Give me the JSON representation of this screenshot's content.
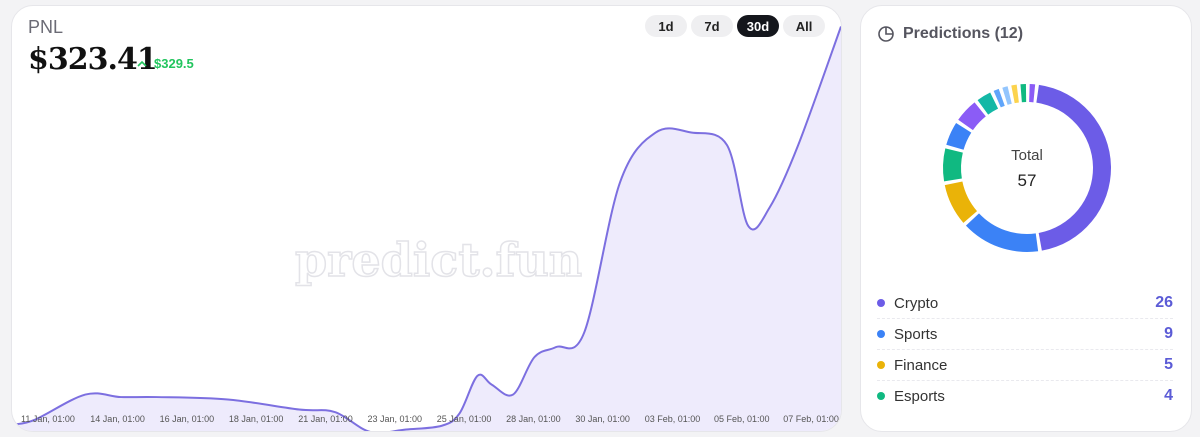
{
  "pnl": {
    "label": "PNL",
    "value": "$323.41",
    "change": "$329.5",
    "ranges": [
      {
        "label": "1d",
        "active": false
      },
      {
        "label": "7d",
        "active": false
      },
      {
        "label": "30d",
        "active": true
      },
      {
        "label": "All",
        "active": false
      }
    ],
    "watermark": "predict.fun"
  },
  "chart_data": {
    "type": "area",
    "x_labels": [
      "11 Jan, 01:00",
      "14 Jan, 01:00",
      "16 Jan, 01:00",
      "18 Jan, 01:00",
      "21 Jan, 01:00",
      "23 Jan, 01:00",
      "25 Jan, 01:00",
      "28 Jan, 01:00",
      "30 Jan, 01:00",
      "03 Feb, 01:00",
      "05 Feb, 01:00",
      "07 Feb, 01:00"
    ],
    "series": [
      {
        "color": "#7c6fe0",
        "fill": "#ebe7fb",
        "x": [
          0,
          0.3,
          1,
          1.5,
          2,
          3,
          4,
          4.5,
          5,
          5.5,
          6,
          6.25,
          6.5,
          6.7,
          7,
          7.3,
          7.6,
          8,
          8.5,
          9,
          9.5,
          10,
          10.3,
          10.6,
          11,
          11.6
        ],
        "y": [
          6,
          10,
          30,
          28,
          28,
          26,
          18,
          16,
          0,
          2,
          5,
          15,
          45,
          38,
          30,
          60,
          68,
          80,
          200,
          240,
          240,
          230,
          165,
          180,
          230,
          325
        ]
      }
    ],
    "ylim": [
      0,
      335
    ],
    "xlim": [
      0,
      11.6
    ]
  },
  "predictions": {
    "title": "Predictions (12)",
    "total_label": "Total",
    "total_value": "57",
    "segments": [
      {
        "value": 26,
        "color": "#6c5ce7"
      },
      {
        "value": 9,
        "color": "#3b82f6"
      },
      {
        "value": 5,
        "color": "#eab308"
      },
      {
        "value": 4,
        "color": "#10b981"
      },
      {
        "value": 3,
        "color": "#3b82f6"
      },
      {
        "value": 3,
        "color": "#8b5cf6"
      },
      {
        "value": 2,
        "color": "#14b8a6"
      },
      {
        "value": 1,
        "color": "#60a5fa"
      },
      {
        "value": 1,
        "color": "#93c5fd"
      },
      {
        "value": 1,
        "color": "#fcd34d"
      },
      {
        "value": 1,
        "color": "#10b981"
      },
      {
        "value": 1,
        "color": "#8b5cf6"
      }
    ],
    "legend": [
      {
        "name": "Crypto",
        "value": "26",
        "color": "#6c5ce7"
      },
      {
        "name": "Sports",
        "value": "9",
        "color": "#3b82f6"
      },
      {
        "name": "Finance",
        "value": "5",
        "color": "#eab308"
      },
      {
        "name": "Esports",
        "value": "4",
        "color": "#10b981"
      }
    ]
  }
}
